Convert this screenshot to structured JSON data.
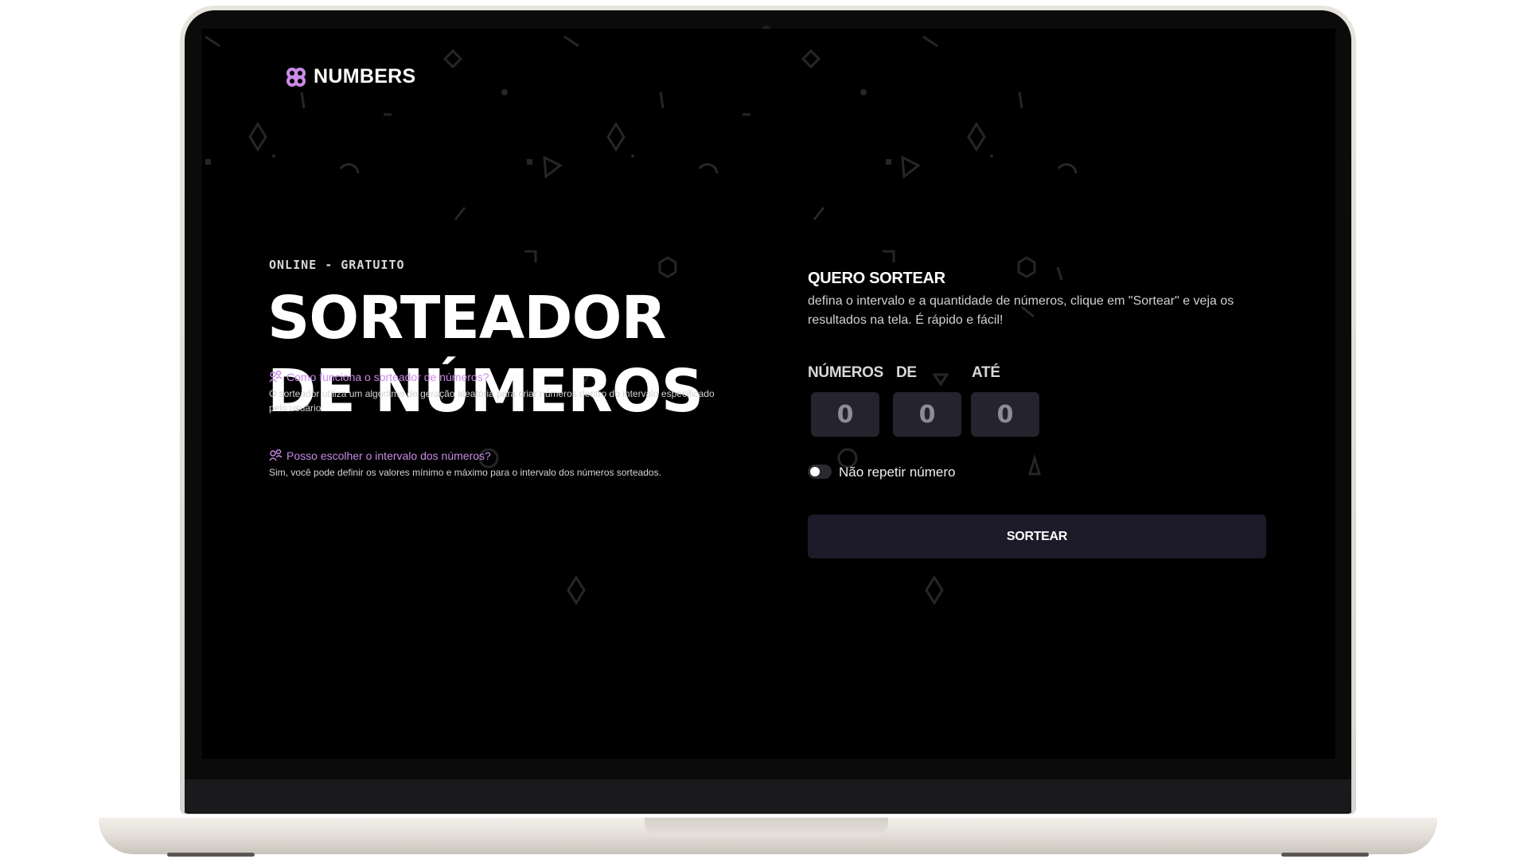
{
  "brand": {
    "name": "NUMBERS",
    "accent_color": "#c98be6"
  },
  "hero": {
    "eyebrow": "ONLINE - GRATUITO",
    "title_line1": "SORTEADOR",
    "title_line2": "DE NÚMEROS"
  },
  "faq": [
    {
      "icon": "people-icon",
      "question": "Como funciona o sorteador de números?",
      "answer": "O sorteador utiliza um algoritmo de geração aleatória para criar números dentro do intervalo especificado pelo usuário."
    },
    {
      "icon": "people-icon",
      "question": "Posso escolher o intervalo dos números?",
      "answer": "Sim, você pode definir os valores mínimo e máximo para o intervalo dos números sorteados."
    }
  ],
  "draw_panel": {
    "title": "QUERO SORTEAR",
    "description": "defina o intervalo e a quantidade de números, clique em \"Sortear\" e veja os resultados na tela. É rápido e fácil!",
    "fields": [
      {
        "label": "NÚMEROS",
        "value": "0"
      },
      {
        "label": "DE",
        "value": "0"
      },
      {
        "label": "ATÉ",
        "value": "0"
      }
    ],
    "no_repeat_label": "Não repetir número",
    "no_repeat_enabled": false,
    "submit_label": "SORTEAR"
  }
}
